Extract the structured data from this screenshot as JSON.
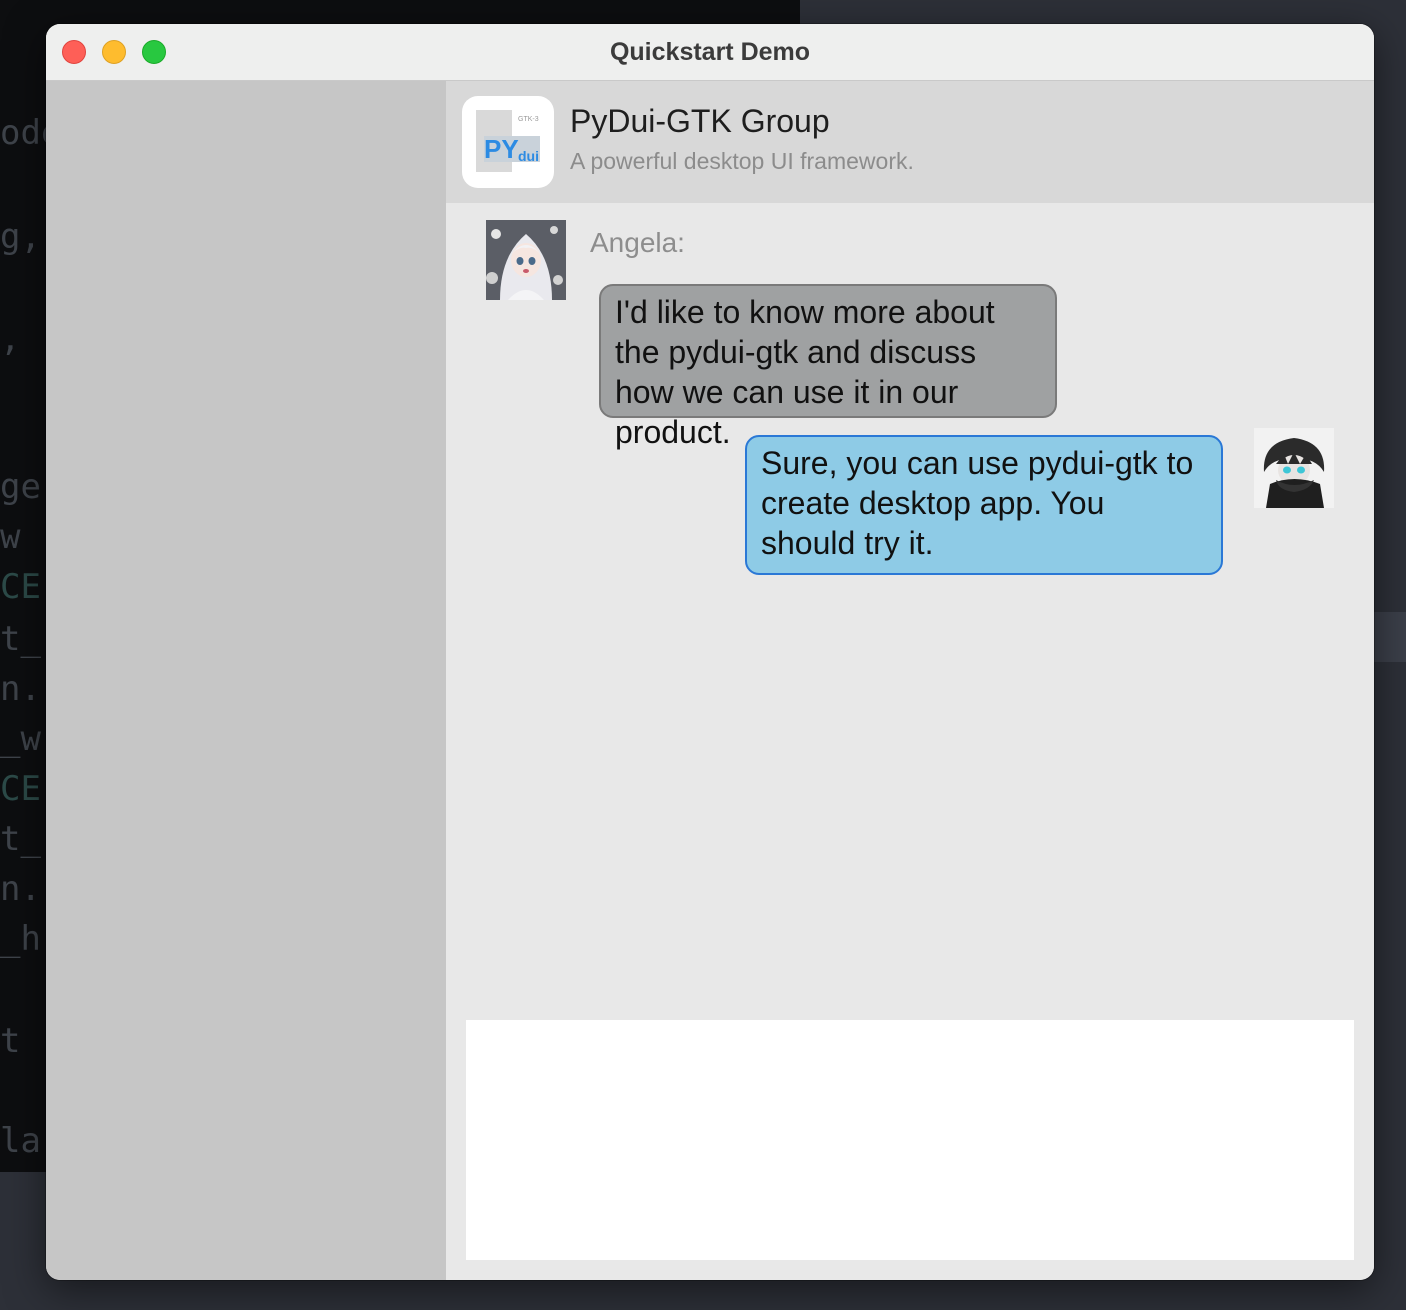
{
  "window": {
    "title": "Quickstart Demo"
  },
  "group": {
    "name": "PyDui-GTK Group",
    "description": "A powerful desktop UI framework.",
    "logo": {
      "badge": "GTK-3",
      "mark_main": "PY",
      "mark_sub": "dui"
    }
  },
  "messages": [
    {
      "direction": "incoming",
      "sender": "Angela:",
      "avatar_icon": "girl-avatar",
      "text": "I'd like to know more about the pydui-gtk and discuss how we can use it in our product."
    },
    {
      "direction": "outgoing",
      "avatar_icon": "boy-avatar",
      "text": "Sure, you can use pydui-gtk to create desktop app. You should try it."
    }
  ],
  "input": {
    "value": ""
  },
  "background_code": [
    "ode",
    "g,",
    ",",
    "ge",
    "w",
    "CE",
    "t_",
    "n.",
    "_w",
    "CE",
    "t_",
    "n.",
    "_h",
    "t",
    "la"
  ],
  "colors": {
    "incoming_bubble": "#9fa1a2",
    "outgoing_bubble": "#8ecbe6",
    "outgoing_border": "#2a78d6",
    "sidebar": "#c6c6c6",
    "header": "#d8d8d8"
  }
}
